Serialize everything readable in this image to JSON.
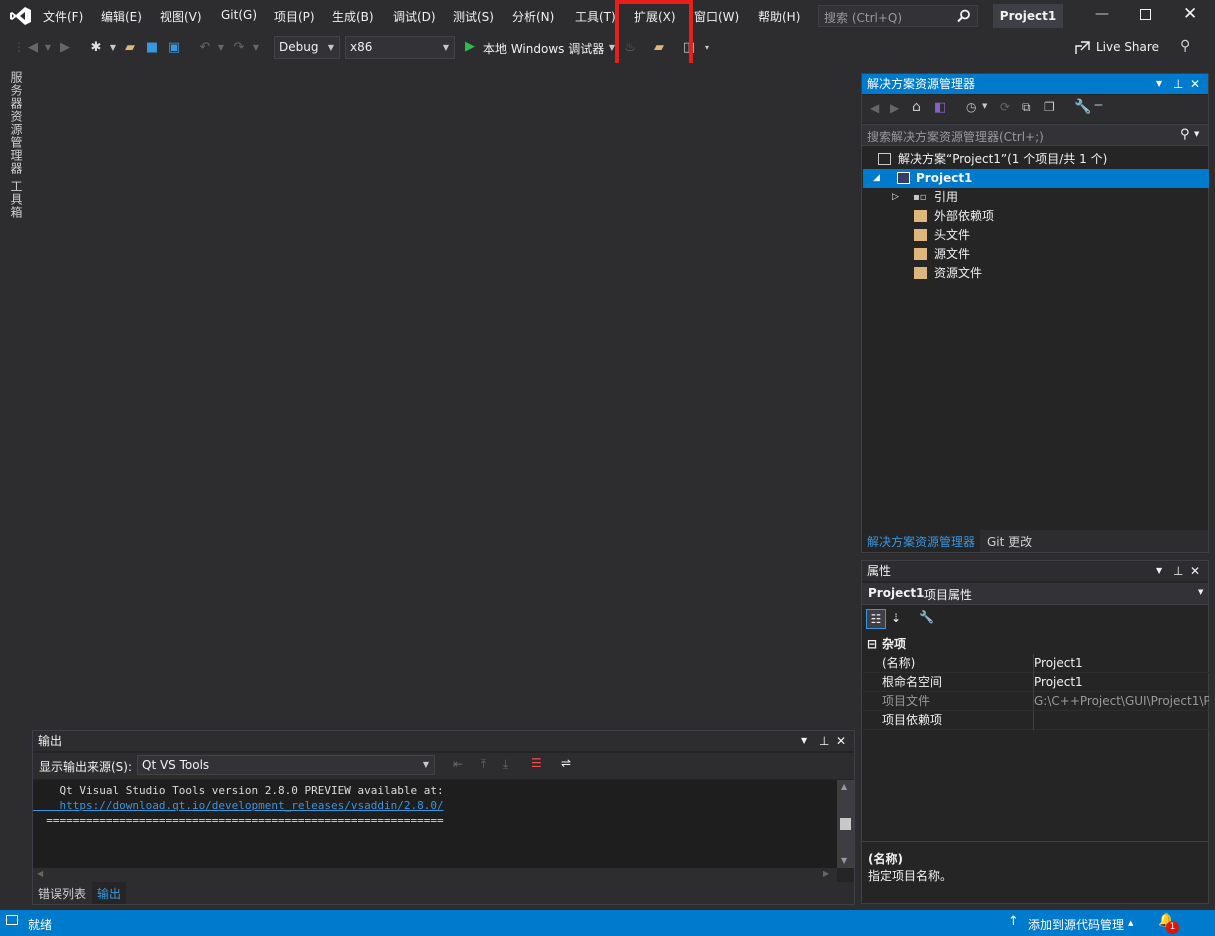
{
  "menu": {
    "items": [
      "文件(F)",
      "编辑(E)",
      "视图(V)",
      "Git(G)",
      "项目(P)",
      "生成(B)",
      "调试(D)",
      "测试(S)",
      "分析(N)",
      "工具(T)",
      "扩展(X)",
      "窗口(W)",
      "帮助(H)"
    ],
    "search_placeholder": "搜索 (Ctrl+Q)",
    "project_title": "Project1"
  },
  "toolbar": {
    "config": "Debug",
    "platform": "x86",
    "run_label": "本地 Windows 调试器",
    "live_share": "Live Share"
  },
  "left_tabs": [
    "服务器资源管理器",
    "工具箱"
  ],
  "solution_explorer": {
    "title": "解决方案资源管理器",
    "search_placeholder": "搜索解决方案资源管理器(Ctrl+;)",
    "solution_node": "解决方案“Project1”(1 个项目/共 1 个)",
    "project_node": "Project1",
    "children": [
      "引用",
      "外部依赖项",
      "头文件",
      "源文件",
      "资源文件"
    ],
    "tabs": [
      "解决方案资源管理器",
      "Git 更改"
    ]
  },
  "properties": {
    "title": "属性",
    "object_name": "Project1",
    "object_type": "项目属性",
    "category": "杂项",
    "rows": [
      {
        "name": "(名称)",
        "value": "Project1"
      },
      {
        "name": "根命名空间",
        "value": "Project1"
      },
      {
        "name": "项目文件",
        "value": "G:\\C++Project\\GUI\\Project1\\P"
      },
      {
        "name": "项目依赖项",
        "value": ""
      }
    ],
    "desc_title": "(名称)",
    "desc_text": "指定项目名称。"
  },
  "output": {
    "title": "输出",
    "source_label": "显示输出来源(S):",
    "source_value": "Qt VS Tools",
    "lines": [
      "    Qt Visual Studio Tools version 2.8.0 PREVIEW available at:",
      "    https://download.qt.io/development_releases/vsaddin/2.8.0/",
      "  ============================================================"
    ],
    "tabs": [
      "错误列表",
      "输出"
    ]
  },
  "status": {
    "text": "就绪",
    "source_control": "添加到源代码管理",
    "notification_count": "1"
  },
  "colors": {
    "accent": "#007acc",
    "highlight": "#e8201c",
    "vs_purple": "#8661c5"
  }
}
